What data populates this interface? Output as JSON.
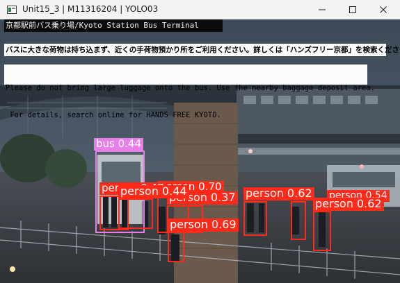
{
  "window": {
    "title": "Unit15_3 | M11316204 | YOLO03",
    "controls": [
      "minimize-icon",
      "maximize-icon",
      "close-icon"
    ]
  },
  "overlay": {
    "station_banner": "京都駅前バス乗り場/Kyoto Station Bus Terminal",
    "jp_notice": "バスに大きな荷物は持ち込まず、近くの手荷物預かり所をご利用ください。詳しくは「ハンズフリー京都」を検索ください。",
    "en_notice_line1": "Please do not bring large luggage onto the bus. Use the nearby baggage deposit area.",
    "en_notice_line2": " For details, search online for HANDS FREE KYOTO."
  },
  "detections": [
    {
      "label": "bus 0.44",
      "color": "#e87ee8"
    },
    {
      "label": "person 0.70",
      "color": "#ff2a1a"
    },
    {
      "label": "person 0.47",
      "color": "#ff2a1a"
    },
    {
      "label": "person 0.44",
      "color": "#ff2a1a"
    },
    {
      "label": "person 0.37",
      "color": "#ff2a1a"
    },
    {
      "label": "person 0.69",
      "color": "#ff2a1a"
    },
    {
      "label": "person 0.62",
      "color": "#ff2a1a"
    },
    {
      "label": "person 0.54",
      "color": "#ff2a1a"
    },
    {
      "label": "person 0.62",
      "color": "#ff2a1a"
    }
  ]
}
